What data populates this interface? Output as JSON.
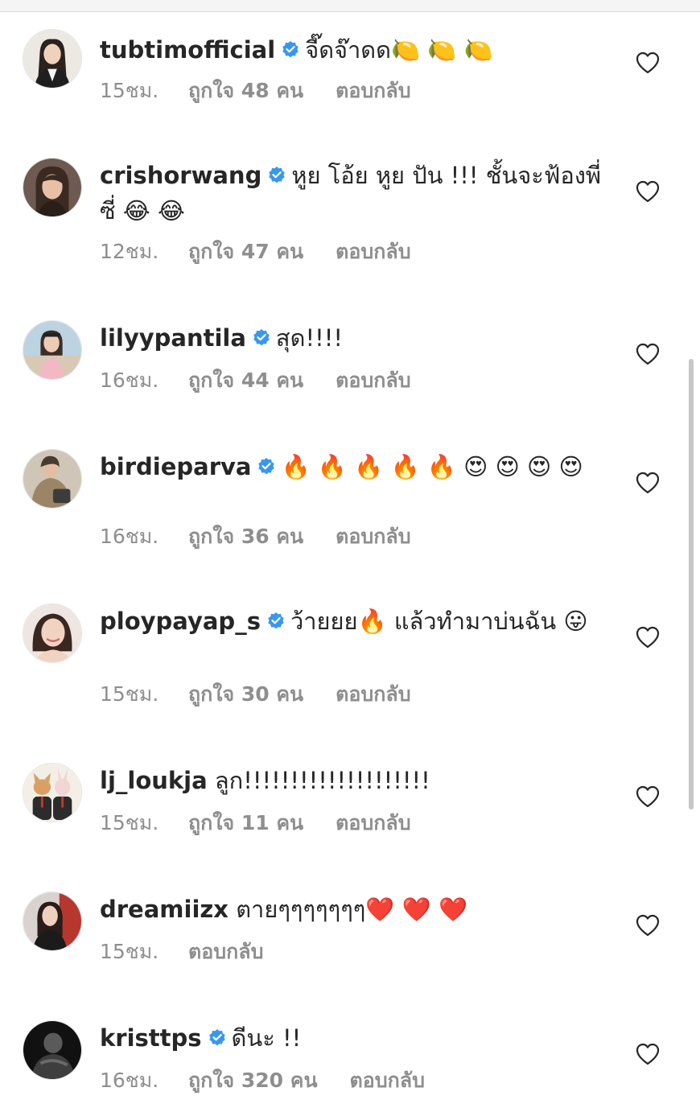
{
  "comments": [
    {
      "username": "tubtimofficial",
      "verified": true,
      "text": "จี๊ดจ๊าดด🍋 🍋 🍋",
      "time": "15ชม.",
      "likes": "ถูกใจ 48 คน",
      "reply": "ตอบกลับ",
      "avatar_icon": "profile-photo-woman-dark-hair"
    },
    {
      "username": "crishorwang",
      "verified": true,
      "text": "หูย โอ้ย หูย ปัน !!! ชั้นจะฟ้องพี่ซี่ 😂 😂",
      "time": "12ชม.",
      "likes": "ถูกใจ 47 คน",
      "reply": "ตอบกลับ",
      "avatar_icon": "profile-photo-woman"
    },
    {
      "username": "lilyypantila",
      "verified": true,
      "text": "สุด!!!!",
      "time": "16ชม.",
      "likes": "ถูกใจ 44 คน",
      "reply": "ตอบกลับ",
      "avatar_icon": "profile-photo-woman-beach"
    },
    {
      "username": "birdieparva",
      "verified": true,
      "text": "🔥 🔥 🔥 🔥 🔥 😍 😍 😍 😍",
      "time": "16ชม.",
      "likes": "ถูกใจ 36 คน",
      "reply": "ตอบกลับ",
      "avatar_icon": "profile-photo-woman-coat"
    },
    {
      "username": "ploypayap_s",
      "verified": true,
      "text": "ว้ายยย🔥 แล้วทำมาบ่นฉัน 😛",
      "time": "15ชม.",
      "likes": "ถูกใจ 30 คน",
      "reply": "ตอบกลับ",
      "avatar_icon": "profile-photo-woman-smiling"
    },
    {
      "username": "lj_loukja",
      "verified": false,
      "text": "ลูก!!!!!!!!!!!!!!!!!!!!",
      "time": "15ชม.",
      "likes": "ถูกใจ 11 คน",
      "reply": "ตอบกลับ",
      "avatar_icon": "profile-illustration-dog-rabbit"
    },
    {
      "username": "dreamiizx",
      "verified": false,
      "text": "ตายๆๆๆๆๆๆๆ❤️ ❤️ ❤️",
      "time": "15ชม.",
      "likes": "",
      "reply": "ตอบกลับ",
      "avatar_icon": "profile-photo-woman-black-outfit"
    },
    {
      "username": "kristtps",
      "verified": true,
      "text": "ดีนะ !!",
      "time": "16ชม.",
      "likes": "ถูกใจ 320 คน",
      "reply": "ตอบกลับ",
      "avatar_icon": "profile-photo-man-monochrome"
    }
  ],
  "icons": {
    "verified": "verified-badge-icon",
    "like": "heart-outline-icon"
  },
  "colors": {
    "verified_blue": "#3897f0",
    "text_primary": "#262626",
    "text_secondary": "#8e8e8e"
  }
}
